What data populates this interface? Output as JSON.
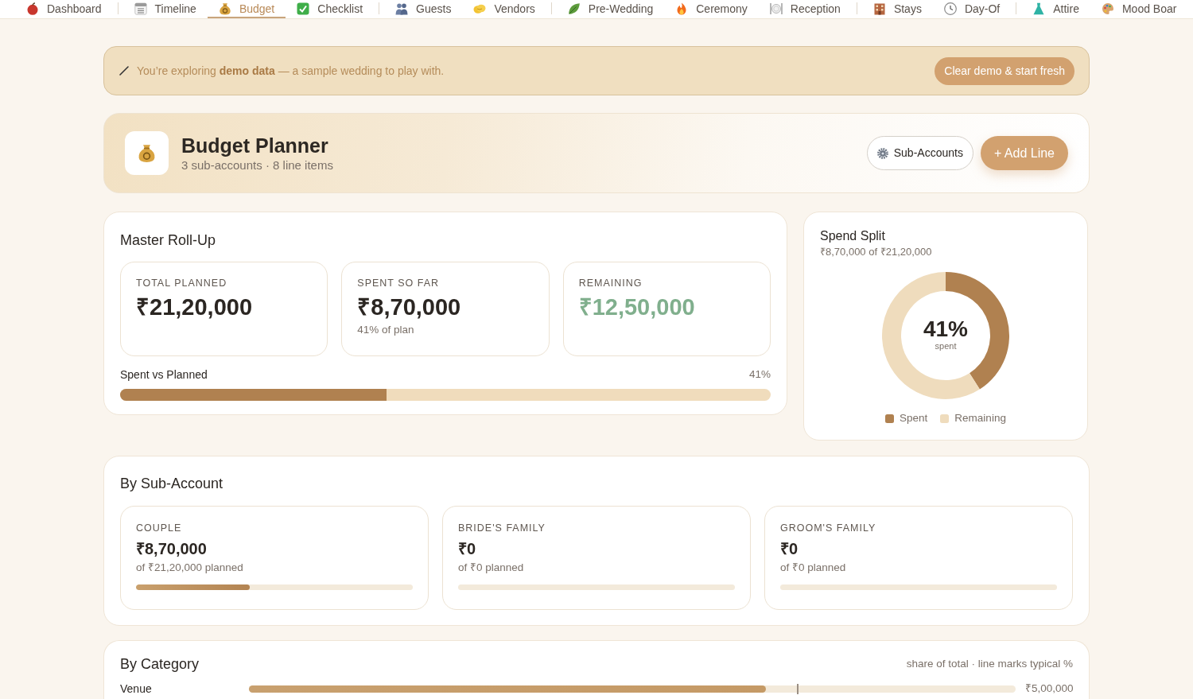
{
  "nav": {
    "groups": [
      {
        "items": [
          {
            "label": "Dashboard",
            "selected": false
          }
        ]
      },
      {
        "items": [
          {
            "label": "Timeline",
            "selected": false
          },
          {
            "label": "Budget",
            "selected": true
          },
          {
            "label": "Checklist",
            "selected": false
          }
        ]
      },
      {
        "items": [
          {
            "label": "Guests",
            "selected": false
          },
          {
            "label": "Vendors",
            "selected": false
          }
        ]
      },
      {
        "items": [
          {
            "label": "Pre-Wedding",
            "selected": false
          },
          {
            "label": "Ceremony",
            "selected": false
          },
          {
            "label": "Reception",
            "selected": false
          }
        ]
      },
      {
        "items": [
          {
            "label": "Stays",
            "selected": false
          },
          {
            "label": "Day-Of",
            "selected": false
          }
        ]
      },
      {
        "items": [
          {
            "label": "Attire",
            "selected": false
          },
          {
            "label": "Mood Boar",
            "selected": false
          }
        ]
      }
    ]
  },
  "demo_banner": {
    "text": "You’re exploring **demo data** — a sample wedding to play with.",
    "button": "Clear demo & start fresh"
  },
  "header": {
    "title": "Budget Planner",
    "subtitle": "3 sub-accounts · 8 line items",
    "buttons": [
      {
        "label": "Sub-Accounts",
        "kind": "secondary"
      },
      {
        "label": "+ Add Line",
        "kind": "primary"
      }
    ]
  },
  "master_rollup": {
    "title": "Master Roll-Up",
    "stats": [
      {
        "label": "TOTAL PLANNED",
        "value": "₹21,20,000",
        "color": "#2b2622"
      },
      {
        "label": "SPENT SO FAR",
        "value": "₹8,70,000",
        "note": "41% of plan",
        "color": "#2b2622"
      },
      {
        "label": "REMAINING",
        "value": "₹12,50,000",
        "color": "#80af8d"
      }
    ],
    "progress": {
      "label": "Spent vs Planned",
      "reading": "41%",
      "level": 0.41
    }
  },
  "spend_split": {
    "title": "Spend Split",
    "subtitle": "₹8,70,000 of ₹21,20,000",
    "center_value": "41%",
    "center_label": "spent",
    "chart_data": {
      "type": "donut",
      "categories": [
        "Spent",
        "Remaining"
      ],
      "values": [
        41,
        59
      ]
    },
    "slices": [
      {
        "color": "#b08150"
      },
      {
        "color": "#efdcbd"
      }
    ]
  },
  "by_sub_account": {
    "title": "By Sub-Account",
    "accounts": [
      {
        "label": "COUPLE",
        "value": "₹8,70,000",
        "note": "of ₹21,20,000 planned",
        "level": 0.41
      },
      {
        "label": "BRIDE'S FAMILY",
        "value": "₹0",
        "note": "of ₹0 planned"
      },
      {
        "label": "GROOM'S FAMILY",
        "value": "₹0",
        "note": "of ₹0 planned"
      }
    ]
  },
  "by_category": {
    "title": "By Category",
    "note": "share of total · line marks typical %",
    "rows": [
      {
        "label": "Venue",
        "level": 0.674,
        "typical_marker": {
          "level": 0.716
        },
        "value": "₹5,00,000"
      }
    ]
  }
}
